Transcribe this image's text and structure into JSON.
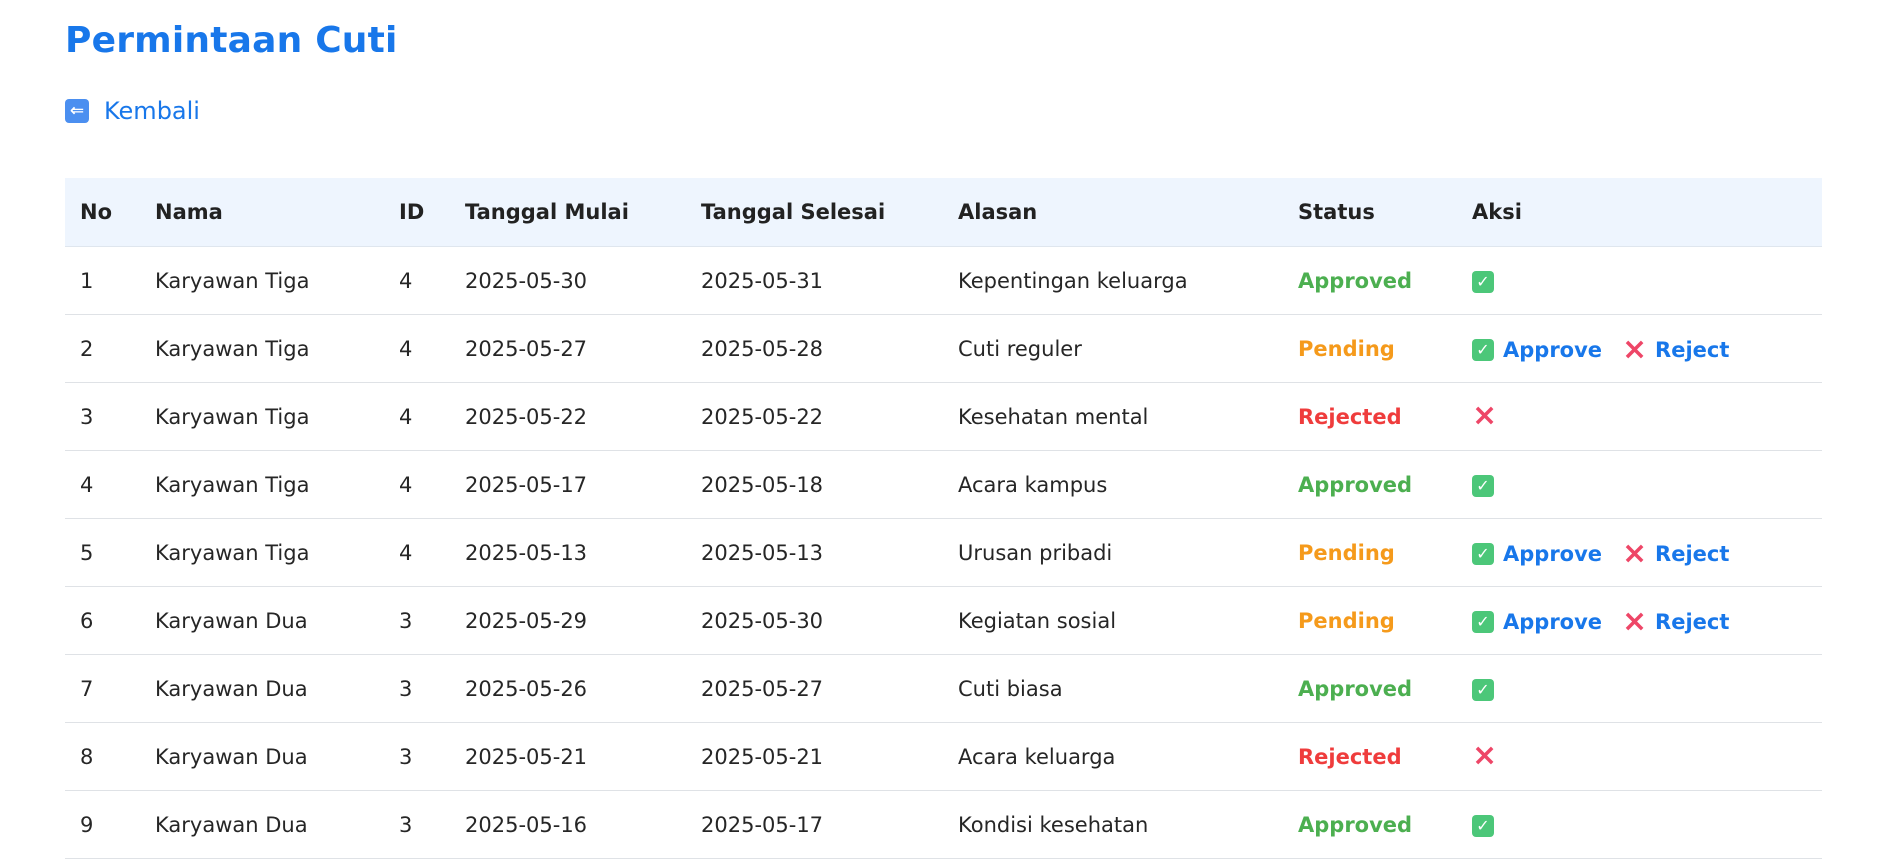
{
  "page": {
    "title": "Permintaan Cuti",
    "back_label": "Kembali"
  },
  "table": {
    "headers": [
      "No",
      "Nama",
      "ID",
      "Tanggal Mulai",
      "Tanggal Selesai",
      "Alasan",
      "Status",
      "Aksi"
    ],
    "rows": [
      {
        "no": "1",
        "nama": "Karyawan Tiga",
        "id": "4",
        "mulai": "2025-05-30",
        "selesai": "2025-05-31",
        "alasan": "Kepentingan keluarga",
        "status": "Approved"
      },
      {
        "no": "2",
        "nama": "Karyawan Tiga",
        "id": "4",
        "mulai": "2025-05-27",
        "selesai": "2025-05-28",
        "alasan": "Cuti reguler",
        "status": "Pending"
      },
      {
        "no": "3",
        "nama": "Karyawan Tiga",
        "id": "4",
        "mulai": "2025-05-22",
        "selesai": "2025-05-22",
        "alasan": "Kesehatan mental",
        "status": "Rejected"
      },
      {
        "no": "4",
        "nama": "Karyawan Tiga",
        "id": "4",
        "mulai": "2025-05-17",
        "selesai": "2025-05-18",
        "alasan": "Acara kampus",
        "status": "Approved"
      },
      {
        "no": "5",
        "nama": "Karyawan Tiga",
        "id": "4",
        "mulai": "2025-05-13",
        "selesai": "2025-05-13",
        "alasan": "Urusan pribadi",
        "status": "Pending"
      },
      {
        "no": "6",
        "nama": "Karyawan Dua",
        "id": "3",
        "mulai": "2025-05-29",
        "selesai": "2025-05-30",
        "alasan": "Kegiatan sosial",
        "status": "Pending"
      },
      {
        "no": "7",
        "nama": "Karyawan Dua",
        "id": "3",
        "mulai": "2025-05-26",
        "selesai": "2025-05-27",
        "alasan": "Cuti biasa",
        "status": "Approved"
      },
      {
        "no": "8",
        "nama": "Karyawan Dua",
        "id": "3",
        "mulai": "2025-05-21",
        "selesai": "2025-05-21",
        "alasan": "Acara keluarga",
        "status": "Rejected"
      },
      {
        "no": "9",
        "nama": "Karyawan Dua",
        "id": "3",
        "mulai": "2025-05-16",
        "selesai": "2025-05-17",
        "alasan": "Kondisi kesehatan",
        "status": "Approved"
      }
    ]
  },
  "actions": {
    "approve_label": "Approve",
    "reject_label": "Reject"
  },
  "icons": {
    "back": "arrow-left-icon",
    "approved": "check-box-icon",
    "rejected": "cross-mark-icon"
  },
  "colors": {
    "accent": "#1877ea",
    "approved": "#4caf50",
    "pending": "#f59a1b",
    "rejected": "#ef3c3c",
    "header_bg": "#eef5fe"
  }
}
